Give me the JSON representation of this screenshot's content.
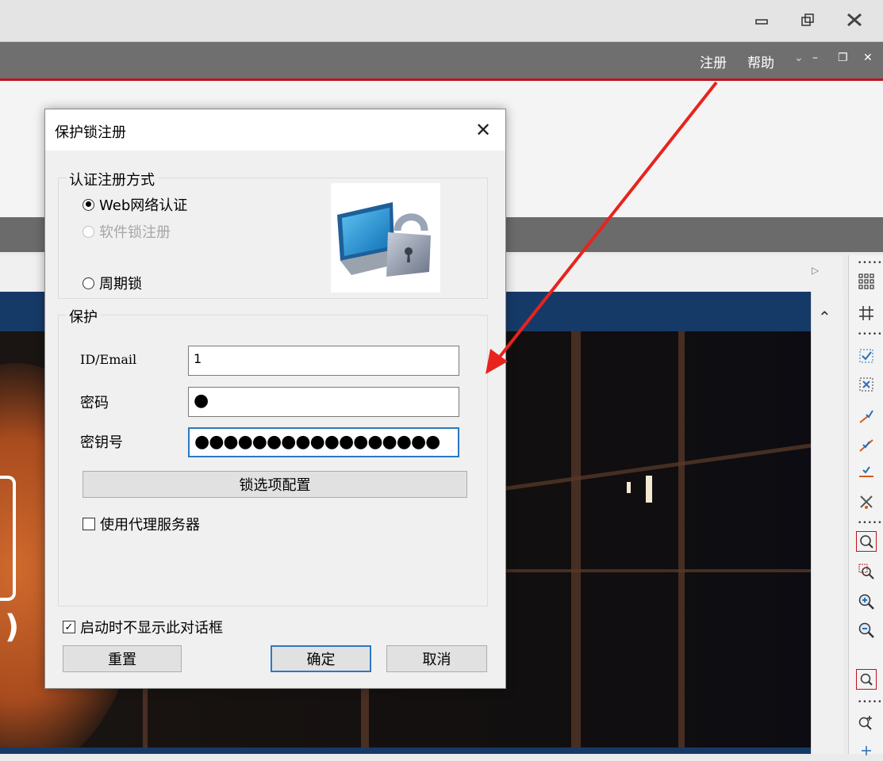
{
  "app": {
    "menu": {
      "register": "注册",
      "help": "帮助"
    },
    "colors": {
      "menubar": "#6f6f6f",
      "accent_red": "#c0111b",
      "canvas_header": "#163a68"
    }
  },
  "dialog": {
    "title": "保护锁注册",
    "auth_group": {
      "legend": "认证注册方式",
      "options": [
        {
          "label": "Web网络认证",
          "selected": true,
          "enabled": true
        },
        {
          "label": "软件锁注册",
          "selected": false,
          "enabled": false
        },
        {
          "label": "周期锁",
          "selected": false,
          "enabled": true
        }
      ],
      "image_icon": "monitor-padlock-icon"
    },
    "protect_group": {
      "legend": "保护",
      "id_label": "ID/Email",
      "id_value": "1",
      "password_label": "密码",
      "password_value": "●",
      "key_label": "密钥号",
      "key_value": "●●●●●●●●●●●●●●●●●",
      "lock_config_button": "锁选项配置",
      "proxy_checkbox": {
        "label": "使用代理服务器",
        "checked": false
      }
    },
    "startup_checkbox": {
      "label": "启动时不显示此对话框",
      "checked": true
    },
    "buttons": {
      "reset": "重置",
      "ok": "确定",
      "cancel": "取消"
    }
  }
}
